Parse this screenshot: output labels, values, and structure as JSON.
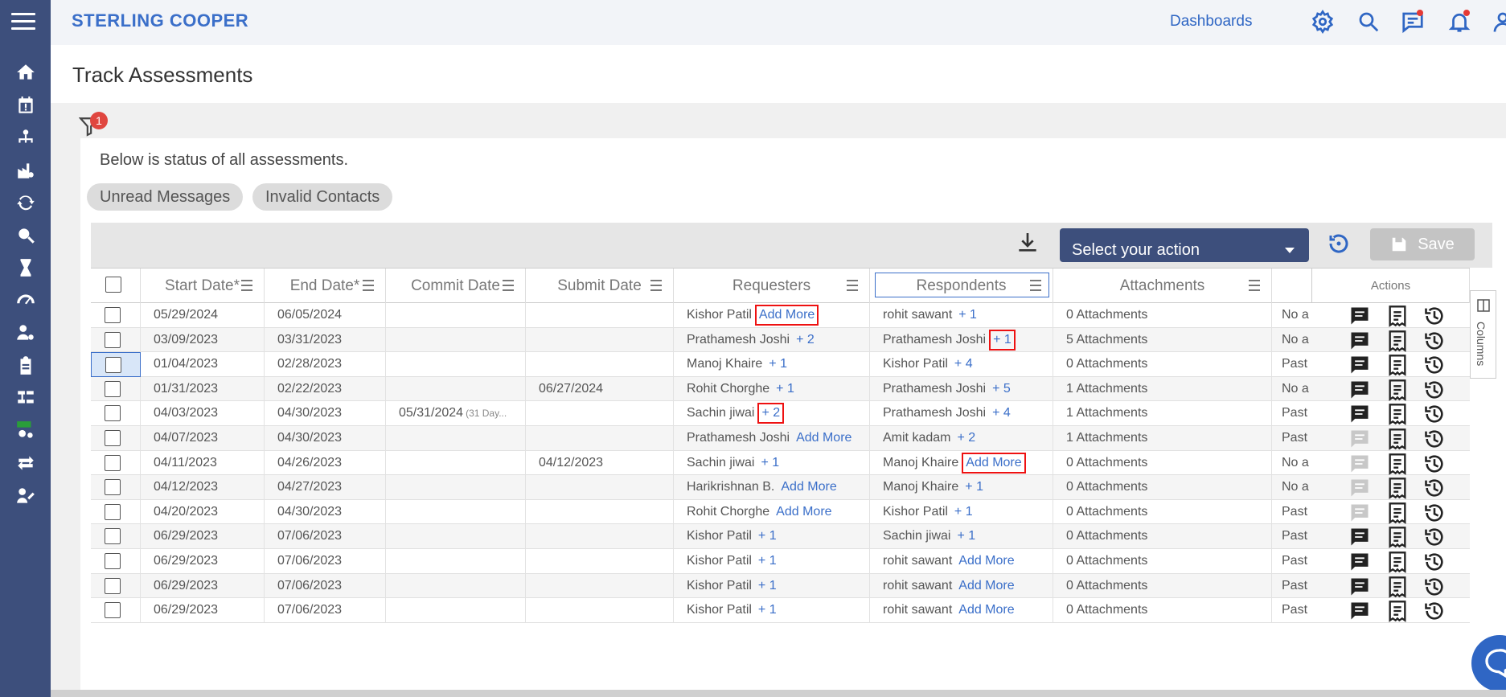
{
  "brand": "STERLING COOPER",
  "topnav": {
    "dashboards": "Dashboards"
  },
  "page_title": "Track Assessments",
  "filter_badge": "1",
  "status_text": "Below is status of all assessments.",
  "chips": [
    "Unread Messages",
    "Invalid Contacts"
  ],
  "toolbar": {
    "select_action": "Select your action",
    "save": "Save"
  },
  "columns_tab": "Columns",
  "headers": {
    "start": "Start Date*",
    "end": "End Date*",
    "commit": "Commit Date",
    "submit": "Submit Date",
    "requesters": "Requesters",
    "respondents": "Respondents",
    "attachments": "Attachments",
    "actions": "Actions"
  },
  "colors": {
    "sidebar": "#3d4f7c",
    "accent": "#3b6fc9",
    "highlight": "#e11111"
  },
  "rows": [
    {
      "start": "05/29/2024",
      "end": "06/05/2024",
      "commit": "",
      "commit_extra": "",
      "submit": "",
      "req": "Kishor Patil",
      "req_link": "Add More",
      "resp": "rohit sawant",
      "resp_link": "+ 1",
      "att": "0 Attachments",
      "extra": "No a"
    },
    {
      "start": "03/09/2023",
      "end": "03/31/2023",
      "commit": "",
      "commit_extra": "",
      "submit": "",
      "req": "Prathamesh Joshi",
      "req_link": "+ 2",
      "resp": "Prathamesh Joshi",
      "resp_link": "+ 1",
      "att": "5 Attachments",
      "extra": "No a"
    },
    {
      "start": "01/04/2023",
      "end": "02/28/2023",
      "commit": "",
      "commit_extra": "",
      "submit": "",
      "req": "Manoj Khaire",
      "req_link": "+ 1",
      "resp": "Kishor Patil",
      "resp_link": "+ 4",
      "att": "0 Attachments",
      "extra": "Past"
    },
    {
      "start": "01/31/2023",
      "end": "02/22/2023",
      "commit": "",
      "commit_extra": "",
      "submit": "06/27/2024",
      "req": "Rohit Chorghe",
      "req_link": "+ 1",
      "resp": "Prathamesh Joshi",
      "resp_link": "+ 5",
      "att": "1 Attachments",
      "extra": "No a"
    },
    {
      "start": "04/03/2023",
      "end": "04/30/2023",
      "commit": "05/31/2024",
      "commit_extra": "(31 Day...",
      "submit": "",
      "req": "Sachin jiwai",
      "req_link": "+ 2",
      "resp": "Prathamesh Joshi",
      "resp_link": "+ 4",
      "att": "1 Attachments",
      "extra": "Past"
    },
    {
      "start": "04/07/2023",
      "end": "04/30/2023",
      "commit": "",
      "commit_extra": "",
      "submit": "",
      "req": "Prathamesh Joshi",
      "req_link": "Add More",
      "resp": "Amit kadam",
      "resp_link": "+ 2",
      "att": "1 Attachments",
      "extra": "Past"
    },
    {
      "start": "04/11/2023",
      "end": "04/26/2023",
      "commit": "",
      "commit_extra": "",
      "submit": "04/12/2023",
      "req": "Sachin jiwai",
      "req_link": "+ 1",
      "resp": "Manoj Khaire",
      "resp_link": "Add More",
      "att": "0 Attachments",
      "extra": "No a"
    },
    {
      "start": "04/12/2023",
      "end": "04/27/2023",
      "commit": "",
      "commit_extra": "",
      "submit": "",
      "req": "Harikrishnan B.",
      "req_link": "Add More",
      "resp": "Manoj Khaire",
      "resp_link": "+ 1",
      "att": "0 Attachments",
      "extra": "No a"
    },
    {
      "start": "04/20/2023",
      "end": "04/30/2023",
      "commit": "",
      "commit_extra": "",
      "submit": "",
      "req": "Rohit Chorghe",
      "req_link": "Add More",
      "resp": "Kishor Patil",
      "resp_link": "+ 1",
      "att": "0 Attachments",
      "extra": "Past"
    },
    {
      "start": "06/29/2023",
      "end": "07/06/2023",
      "commit": "",
      "commit_extra": "",
      "submit": "",
      "req": "Kishor Patil",
      "req_link": "+ 1",
      "resp": "Sachin jiwai",
      "resp_link": "+ 1",
      "att": "0 Attachments",
      "extra": "Past"
    },
    {
      "start": "06/29/2023",
      "end": "07/06/2023",
      "commit": "",
      "commit_extra": "",
      "submit": "",
      "req": "Kishor Patil",
      "req_link": "+ 1",
      "resp": "rohit sawant",
      "resp_link": "Add More",
      "att": "0 Attachments",
      "extra": "Past"
    },
    {
      "start": "06/29/2023",
      "end": "07/06/2023",
      "commit": "",
      "commit_extra": "",
      "submit": "",
      "req": "Kishor Patil",
      "req_link": "+ 1",
      "resp": "rohit sawant",
      "resp_link": "Add More",
      "att": "0 Attachments",
      "extra": "Past"
    },
    {
      "start": "06/29/2023",
      "end": "07/06/2023",
      "commit": "",
      "commit_extra": "",
      "submit": "",
      "req": "Kishor Patil",
      "req_link": "+ 1",
      "resp": "rohit sawant",
      "resp_link": "Add More",
      "att": "0 Attachments",
      "extra": "Past"
    }
  ],
  "boxed_links": [
    {
      "row": 0,
      "col": "req"
    },
    {
      "row": 1,
      "col": "resp"
    },
    {
      "row": 4,
      "col": "req"
    },
    {
      "row": 6,
      "col": "resp"
    }
  ],
  "grey_message_rows": [
    5,
    6,
    7,
    8
  ]
}
